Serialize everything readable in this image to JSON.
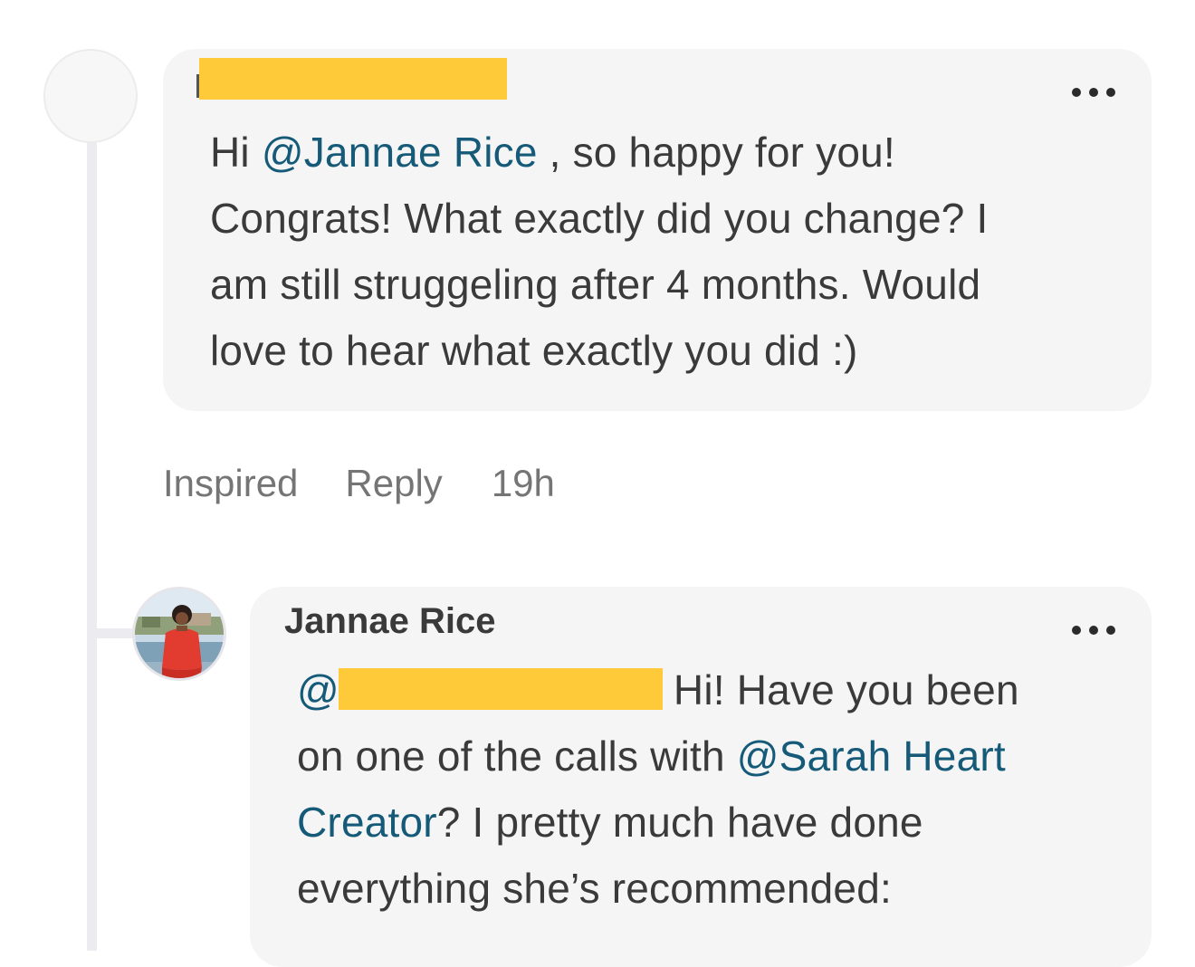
{
  "comments": [
    {
      "author": "",
      "author_redacted": true,
      "text_lines": [
        {
          "before": "Hi ",
          "mention": "@Jannae Rice",
          "after": " , so happy for you!"
        },
        {
          "before": "Congrats! What exactly did you change? I",
          "mention": "",
          "after": ""
        },
        {
          "before": "am still struggeling after 4 months. Would",
          "mention": "",
          "after": ""
        },
        {
          "before": "love to hear what exactly you did :)",
          "mention": "",
          "after": ""
        }
      ],
      "actions": {
        "inspired_label": "Inspired",
        "reply_label": "Reply",
        "timestamp": "19h"
      },
      "more_icon": "more-horizontal-icon"
    },
    {
      "author": "Jannae Rice",
      "text_lines": [
        {
          "before": "",
          "mention": "@",
          "after": "",
          "tail": "Hi! Have you been"
        },
        {
          "before": "on one of the calls with ",
          "mention": "@Sarah Heart",
          "after": ""
        },
        {
          "before": "",
          "mention": "Creator",
          "after": "? I pretty much have done"
        },
        {
          "before": "everything she’s recommended:",
          "mention": "",
          "after": ""
        }
      ],
      "more_icon": "more-horizontal-icon"
    }
  ],
  "colors": {
    "mention": "#155a78",
    "bubble": "#f5f5f5",
    "redaction": "#ffca3a",
    "thread_line": "#ececf0",
    "action_text": "#757575"
  }
}
